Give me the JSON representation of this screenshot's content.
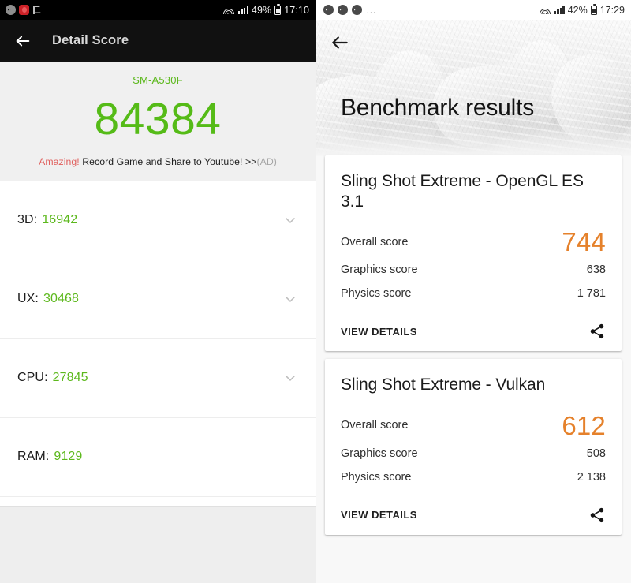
{
  "left_phone": {
    "status_bar": {
      "icons": [
        "messenger-icon",
        "red-app-icon",
        "flag-icon"
      ],
      "battery_percent": "49%",
      "time": "17:10",
      "wifi": "wifi-icon",
      "signal": "cellular-signal-icon",
      "battery": "battery-icon"
    },
    "app_bar": {
      "back": "back-arrow-icon",
      "title": "Detail Score"
    },
    "hero": {
      "device_model": "SM-A530F",
      "total_score": "84384",
      "ad": {
        "highlight": "Amazing!",
        "main": " Record Game and Share to Youtube! >>",
        "tag": "(AD)"
      }
    },
    "rows": [
      {
        "label": "3D:",
        "value": "16942",
        "expandable": true
      },
      {
        "label": "UX:",
        "value": "30468",
        "expandable": true
      },
      {
        "label": "CPU:",
        "value": "27845",
        "expandable": true
      },
      {
        "label": "RAM:",
        "value": "9129",
        "expandable": false
      }
    ],
    "colors": {
      "score_green": "#55bb17",
      "ad_red": "#e0605e"
    }
  },
  "right_phone": {
    "status_bar": {
      "icons": [
        "messenger-icon",
        "messenger-icon",
        "messenger-icon"
      ],
      "overflow": "…",
      "battery_percent": "42%",
      "time": "17:29"
    },
    "hero": {
      "back": "back-arrow-icon",
      "title": "Benchmark results"
    },
    "cards": [
      {
        "title": "Sling Shot Extreme - OpenGL ES 3.1",
        "overall_label": "Overall score",
        "overall_value": "744",
        "rows": [
          {
            "label": "Graphics score",
            "value": "638"
          },
          {
            "label": "Physics score",
            "value": "1 781"
          }
        ],
        "action_label": "VIEW DETAILS",
        "share_icon": "share-icon"
      },
      {
        "title": "Sling Shot Extreme - Vulkan",
        "overall_label": "Overall score",
        "overall_value": "612",
        "rows": [
          {
            "label": "Graphics score",
            "value": "508"
          },
          {
            "label": "Physics score",
            "value": "2 138"
          }
        ],
        "action_label": "VIEW DETAILS",
        "share_icon": "share-icon"
      }
    ],
    "colors": {
      "overall_orange": "#e5812b"
    }
  }
}
